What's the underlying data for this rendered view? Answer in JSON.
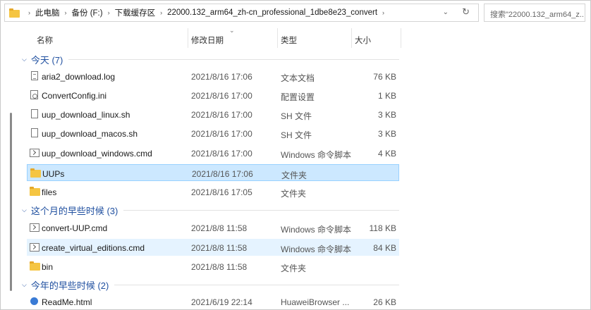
{
  "address_bar": {
    "crumbs": [
      "此电脑",
      "备份 (F:)",
      "下载缓存区",
      "22000.132_arm64_zh-cn_professional_1dbe8e23_convert"
    ]
  },
  "search": {
    "placeholder": "搜索\"22000.132_arm64_z..."
  },
  "columns": {
    "name": "名称",
    "date": "修改日期",
    "type": "类型",
    "size": "大小"
  },
  "groups": [
    {
      "label": "今天 (7)"
    },
    {
      "label": "这个月的早些时候 (3)"
    },
    {
      "label": "今年的早些时候 (2)"
    }
  ],
  "files": [
    {
      "name": "aria2_download.log",
      "date": "2021/8/16 17:06",
      "type": "文本文档",
      "size": "76 KB",
      "icon": "text-file-icon"
    },
    {
      "name": "ConvertConfig.ini",
      "date": "2021/8/16 17:00",
      "type": "配置设置",
      "size": "1 KB",
      "icon": "settings-file-icon"
    },
    {
      "name": "uup_download_linux.sh",
      "date": "2021/8/16 17:00",
      "type": "SH 文件",
      "size": "3 KB",
      "icon": "file-icon"
    },
    {
      "name": "uup_download_macos.sh",
      "date": "2021/8/16 17:00",
      "type": "SH 文件",
      "size": "3 KB",
      "icon": "file-icon"
    },
    {
      "name": "uup_download_windows.cmd",
      "date": "2021/8/16 17:00",
      "type": "Windows 命令脚本",
      "size": "4 KB",
      "icon": "command-script-icon"
    },
    {
      "name": "UUPs",
      "date": "2021/8/16 17:06",
      "type": "文件夹",
      "size": "",
      "icon": "folder-icon"
    },
    {
      "name": "files",
      "date": "2021/8/16 17:05",
      "type": "文件夹",
      "size": "",
      "icon": "folder-icon"
    },
    {
      "name": "convert-UUP.cmd",
      "date": "2021/8/8 11:58",
      "type": "Windows 命令脚本",
      "size": "118 KB",
      "icon": "command-script-icon"
    },
    {
      "name": "create_virtual_editions.cmd",
      "date": "2021/8/8 11:58",
      "type": "Windows 命令脚本",
      "size": "84 KB",
      "icon": "command-script-icon"
    },
    {
      "name": "bin",
      "date": "2021/8/8 11:58",
      "type": "文件夹",
      "size": "",
      "icon": "folder-icon"
    },
    {
      "name": "ReadMe.html",
      "date": "2021/6/19 22:14",
      "type": "HuaweiBrowser ...",
      "size": "26 KB",
      "icon": "browser-html-icon"
    }
  ],
  "colors": {
    "selected_bg": "#cce8ff",
    "hover_bg": "#e5f3ff",
    "group_label": "#2050a0",
    "folder": "#f5c542"
  }
}
